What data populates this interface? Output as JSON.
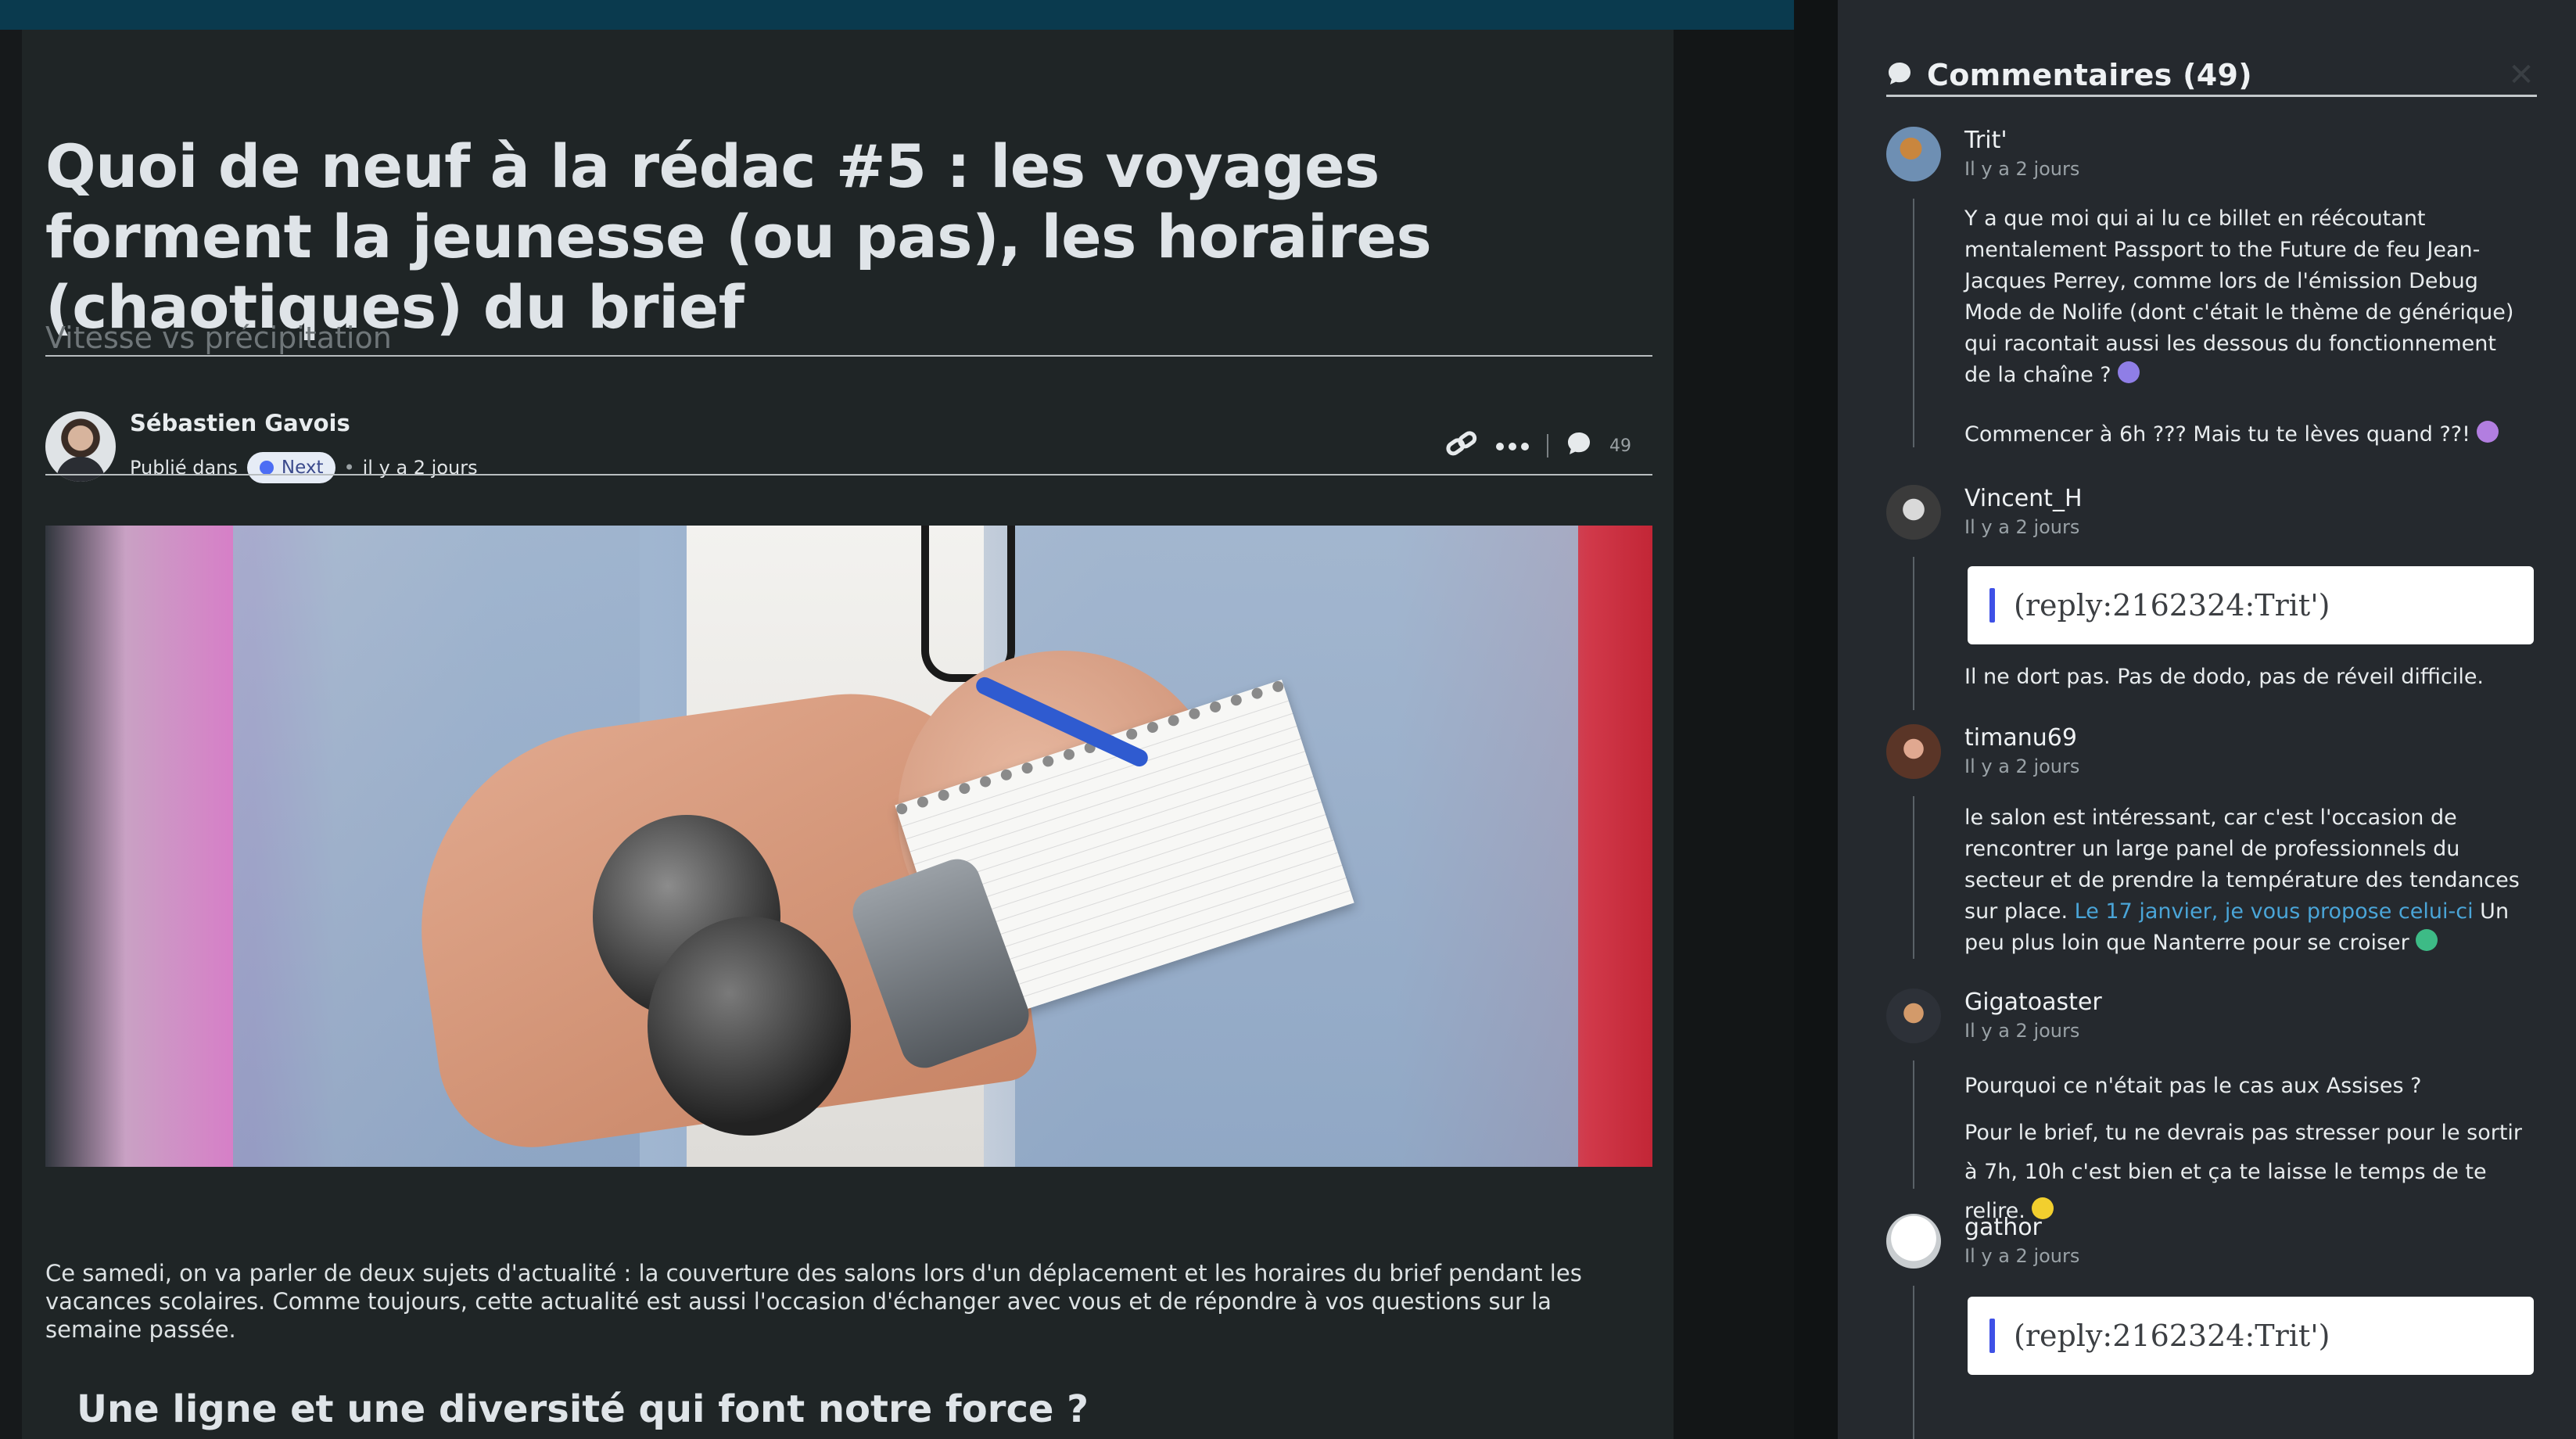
{
  "article": {
    "title": "Quoi de neuf à la rédac #5 : les voyages forment la jeunesse (ou pas), les horaires (chaotiques) du brief",
    "subtitle": "Vitesse vs précipitation",
    "author": "Sébastien Gavois",
    "published_prefix": "Publié dans",
    "section_tag": "Next",
    "published_date": "il y a 2 jours",
    "comment_count": "49",
    "intro": "Ce samedi, on va parler de deux sujets d'actualité : la couverture des salons lors d'un déplacement et les horaires du brief pendant les vacances scolaires. Comme toujours, cette actualité est aussi l'occasion d'échanger avec vous et de répondre à vos questions sur la semaine passée.",
    "section_heading": "Une ligne et une diversité qui font notre force ?"
  },
  "comments_panel": {
    "title": "Commentaires (49)",
    "comments": [
      {
        "author": "Trit'",
        "date": "Il y a 2 jours",
        "paragraphs": [
          "Y a que moi qui ai lu ce billet en réécoutant mentalement Passport to the Future de feu Jean-Jacques Perrey, comme lors de l'émission Debug Mode de Nolife (dont c'était le thème de générique) qui racontait aussi les dessous du fonctionnement de la chaîne ?",
          "Commencer à 6h ??? Mais tu te lèves quand ??!"
        ]
      },
      {
        "author": "Vincent_H",
        "date": "Il y a 2 jours",
        "quote": "(reply:2162324:Trit')",
        "paragraphs": [
          "Il ne dort pas. Pas de dodo, pas de réveil difficile."
        ]
      },
      {
        "author": "timanu69",
        "date": "Il y a 2 jours",
        "text_before_link": "le salon est intéressant, car c'est l'occasion de rencontrer un large panel de professionnels du secteur et de prendre la température des tendances sur place. ",
        "link": "Le 17 janvier, je vous propose celui-ci",
        "text_after_link": " Un peu plus loin que Nanterre pour se croiser"
      },
      {
        "author": "Gigatoaster",
        "date": "Il y a 2 jours",
        "paragraphs": [
          "Pourquoi ce n'était pas le cas aux Assises ?",
          "Pour le brief, tu ne devrais pas stresser pour le sortir à 7h, 10h c'est bien et ça te laisse le temps de te relire."
        ]
      },
      {
        "author": "gathor",
        "date": "Il y a 2 jours",
        "quote": "(reply:2162324:Trit')"
      }
    ]
  },
  "colors": {
    "top_bar": "#0a3a4e",
    "article_bg": "#1f2526",
    "panel_bg": "#25292e",
    "tag_dot": "#4c6df4",
    "link": "#4aa5d8",
    "quote_bar": "#3f51e6"
  }
}
